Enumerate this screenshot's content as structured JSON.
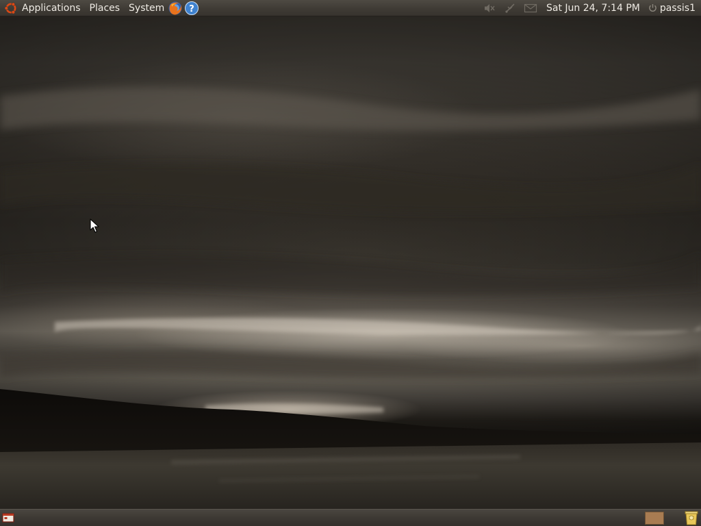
{
  "top_panel": {
    "menus": {
      "applications": "Applications",
      "places": "Places",
      "system": "System"
    },
    "launchers": [
      "firefox-icon",
      "help-icon"
    ],
    "tray": [
      "volume-icon",
      "network-icon",
      "mail-icon"
    ],
    "clock": "Sat Jun 24,  7:14 PM",
    "user": "passis1"
  },
  "bottom_panel": {
    "items": [
      "show-desktop-icon",
      "workspace-switcher",
      "trash-icon"
    ]
  },
  "colors": {
    "panel": "#3f3b35",
    "panel_text": "#efebe4",
    "workspace_active": "#a87c52",
    "ubuntu_orange": "#dd4814"
  }
}
